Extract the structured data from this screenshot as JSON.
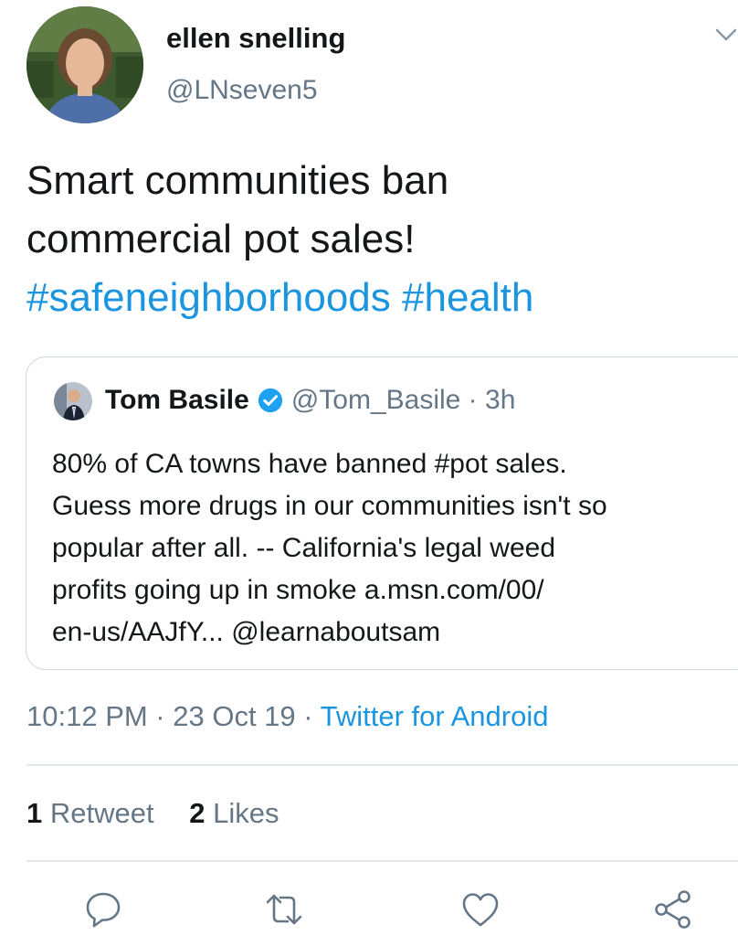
{
  "author": {
    "name": "ellen snelling",
    "handle": "@LNseven5"
  },
  "tweet": {
    "line1": "Smart communities ban",
    "line2": "commercial pot sales!",
    "hashtag1": "#safeneighborhoods",
    "hashtag2": "#health"
  },
  "quoted": {
    "name": "Tom Basile",
    "handle_time": "@Tom_Basile · 3h",
    "lines": [
      "80% of CA towns have banned #pot sales.",
      "Guess more drugs in our communities isn't so",
      "popular after all.  -- California's legal weed",
      "profits going up in smoke a.msn.com/00/",
      "en-us/AAJfY... @learnaboutsam"
    ]
  },
  "meta": {
    "timestamp": "10:12 PM · 23 Oct 19 · ",
    "source": "Twitter for Android"
  },
  "stats": {
    "retweets_count": "1",
    "retweets_label": "Retweet",
    "likes_count": "2",
    "likes_label": "Likes"
  },
  "icons": {
    "reply": "reply-icon",
    "retweet": "retweet-icon",
    "like": "heart-icon",
    "share": "share-icon",
    "more": "chevron-down-icon",
    "verified": "verified-badge-icon"
  },
  "colors": {
    "link": "#1b95e0",
    "secondary_text": "#657786",
    "border": "#ccd6dd",
    "verified": "#1da1f2"
  }
}
